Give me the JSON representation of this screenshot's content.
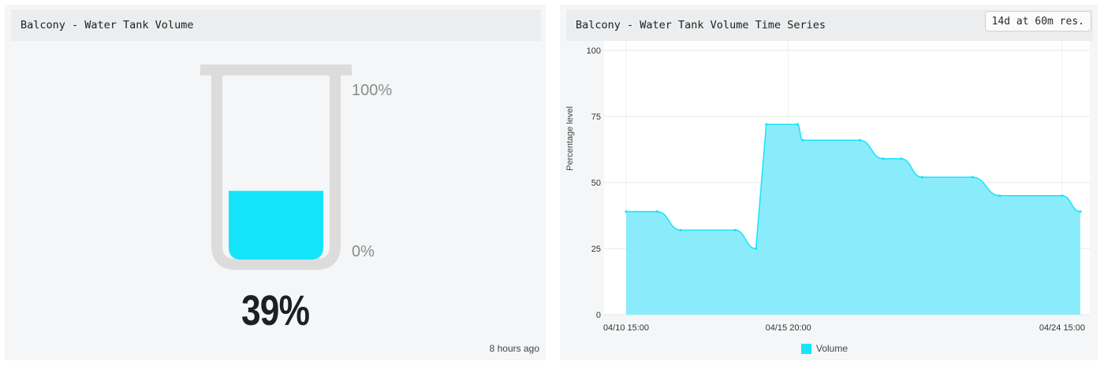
{
  "left_panel": {
    "title": "Balcony - Water Tank Volume",
    "gauge": {
      "value_percent": 39,
      "value_text": "39%",
      "max_label": "100%",
      "min_label": "0%",
      "fill_color": "#16e4fa",
      "tube_color": "#dcdcdc"
    },
    "last_updated": "8 hours ago"
  },
  "right_panel": {
    "title": "Balcony - Water Tank Volume Time Series",
    "resolution_badge": "14d at 60m res.",
    "chart_data": {
      "type": "area",
      "ylabel": "Percentage level",
      "ylim": [
        0,
        100
      ],
      "yticks": [
        0,
        25,
        50,
        75,
        100
      ],
      "xlim": [
        "04/10 15:00",
        "04/25 05:00"
      ],
      "xticks": [
        "04/10 15:00",
        "04/15 20:00",
        "04/24 15:00"
      ],
      "grid": true,
      "legend_position": "bottom",
      "series": [
        {
          "name": "Volume",
          "color": "#16e4fa",
          "fill_color": "#8aecfa",
          "points": [
            [
              "04/10 15:00",
              39
            ],
            [
              "04/11 15:00",
              39
            ],
            [
              "04/12 09:00",
              32
            ],
            [
              "04/14 03:00",
              32
            ],
            [
              "04/14 19:00",
              25
            ],
            [
              "04/15 03:00",
              72
            ],
            [
              "04/16 03:00",
              72
            ],
            [
              "04/16 07:00",
              66
            ],
            [
              "04/18 03:00",
              66
            ],
            [
              "04/18 21:00",
              59
            ],
            [
              "04/19 11:00",
              59
            ],
            [
              "04/20 03:00",
              52
            ],
            [
              "04/21 18:00",
              52
            ],
            [
              "04/22 15:00",
              45
            ],
            [
              "04/24 15:00",
              45
            ],
            [
              "04/25 05:00",
              39
            ]
          ]
        }
      ]
    }
  }
}
